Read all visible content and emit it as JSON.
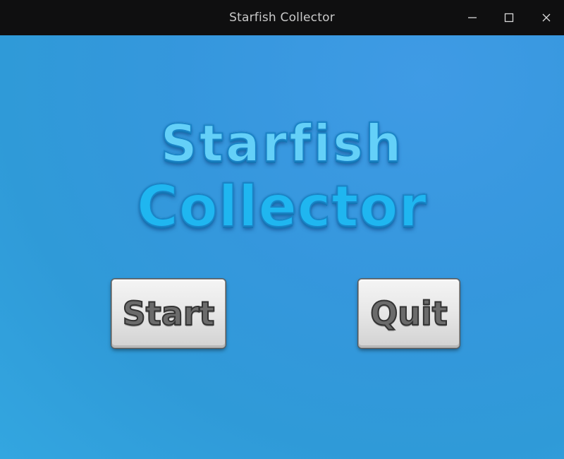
{
  "window": {
    "title": "Starfish Collector",
    "controls": {
      "minimize_icon": "minimize-icon",
      "maximize_icon": "maximize-icon",
      "close_icon": "close-icon"
    }
  },
  "game": {
    "logo": {
      "line1": "Starfish",
      "line2": "Collector"
    },
    "menu": {
      "start_label": "Start",
      "quit_label": "Quit"
    }
  },
  "colors": {
    "titlebar": "#0f0f10",
    "background": "#3597dd",
    "logo_fill": "#45c3f4",
    "button_face": "#e8e8e8",
    "button_text": "#6b6b6b"
  }
}
